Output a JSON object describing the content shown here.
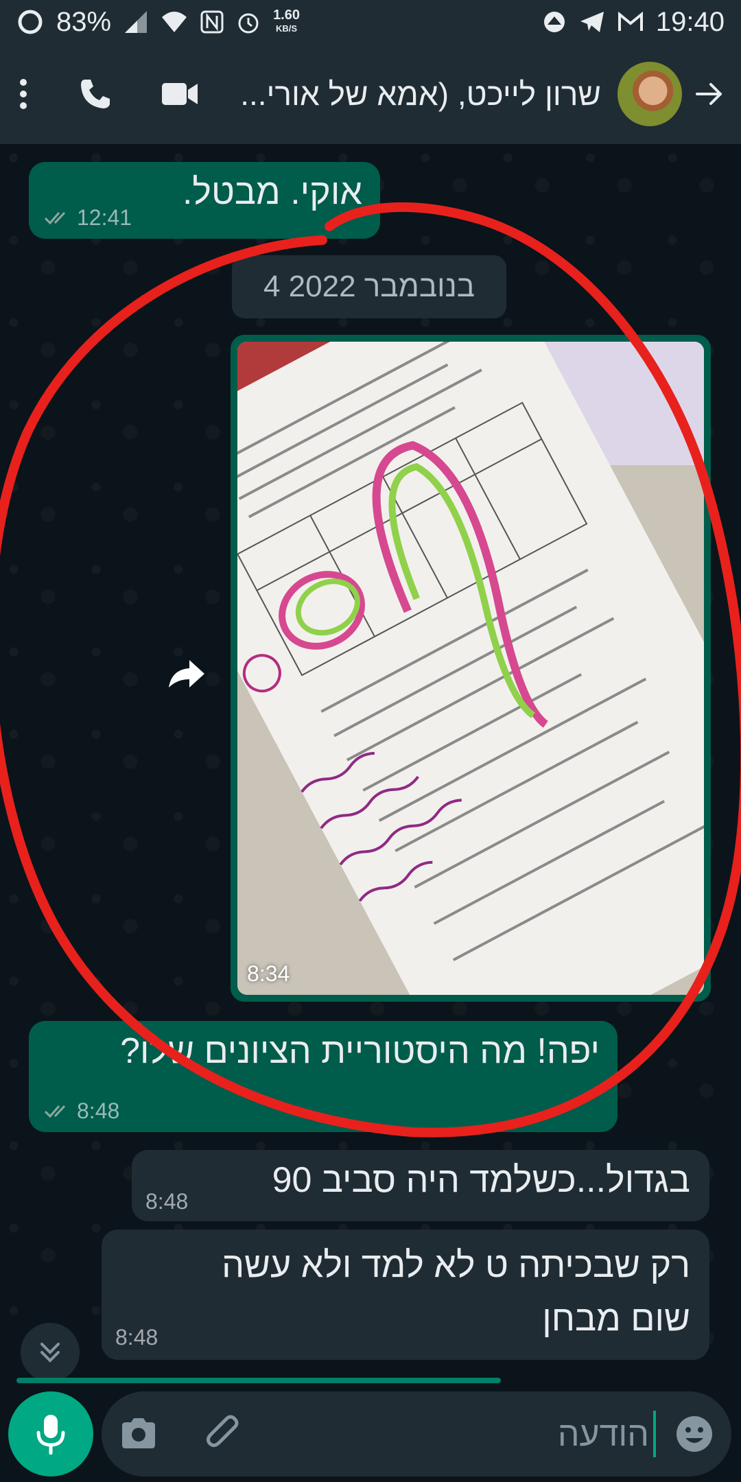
{
  "status_bar": {
    "battery": "83%",
    "net_speed_value": "1.60",
    "net_speed_unit": "KB/S",
    "time": "19:40"
  },
  "header": {
    "contact_name": "שרון לייכט, (אמא של אורי...",
    "back_icon": "arrow-right-icon",
    "call_icon": "phone-icon",
    "video_icon": "video-camera-icon",
    "menu_icon": "kebab-menu-icon"
  },
  "messages": [
    {
      "text": "אוקי. מבטל.",
      "time": "12:41",
      "direction": "out",
      "status": "read"
    },
    {
      "date_separator": "4 בנובמבר 2022"
    },
    {
      "type": "image",
      "time": "8:34",
      "direction": "out"
    },
    {
      "text": "יפה! מה היסטוריית הציונים שלו?",
      "time": "8:48",
      "direction": "out",
      "status": "read"
    },
    {
      "text": "בגדול...כשלמד היה סביב 90",
      "time": "8:48",
      "direction": "in"
    },
    {
      "text_line1": "רק שבכיתה ט לא למד ולא עשה",
      "text_line2": "שום מבחן",
      "time": "8:48",
      "direction": "in"
    }
  ],
  "input": {
    "placeholder": "הודעה"
  },
  "colors": {
    "header_bg": "#1f2c34",
    "chat_bg": "#0b141a",
    "outgoing_bubble": "#005c4b",
    "incoming_bubble": "#202c33",
    "accent": "#00a884",
    "annotation_red": "#e8211d"
  }
}
